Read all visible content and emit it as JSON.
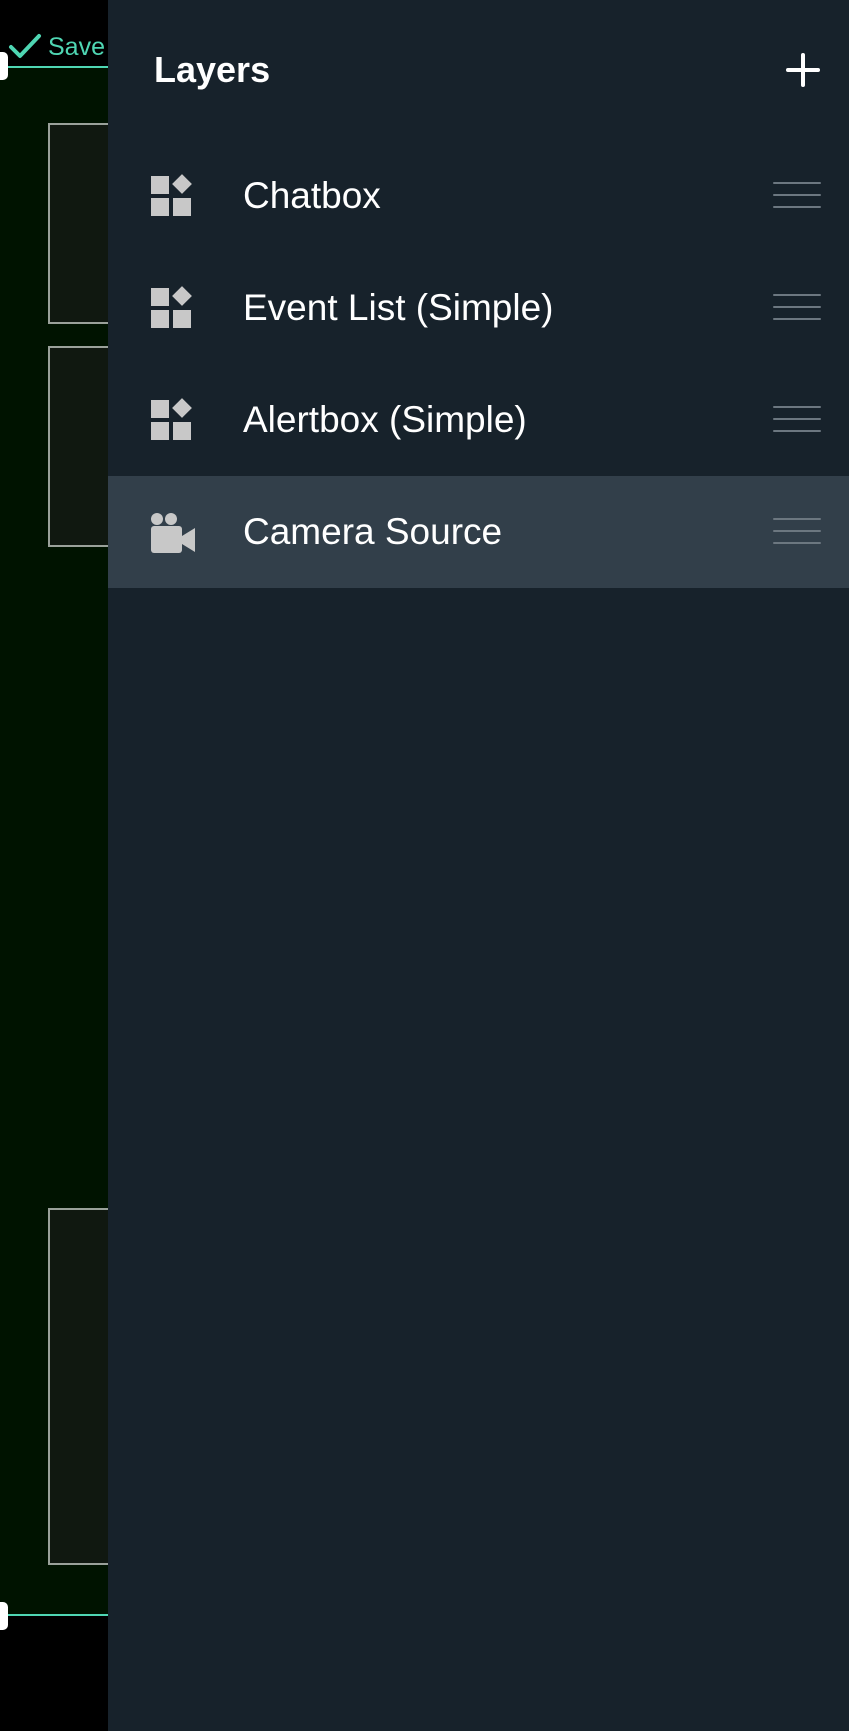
{
  "colors": {
    "panel_bg": "#17222b",
    "selected_row_bg": "#323f4a",
    "accent": "#4fd6b3",
    "stage_bg": "#001300",
    "icon_gray": "#c8c8c8"
  },
  "canvas": {
    "save_label": "Save",
    "save_icon": "check-icon"
  },
  "panel": {
    "title": "Layers",
    "add_icon": "plus-icon",
    "layers": [
      {
        "label": "Chatbox",
        "icon": "widget-icon",
        "selected": false
      },
      {
        "label": "Event List (Simple)",
        "icon": "widget-icon",
        "selected": false
      },
      {
        "label": "Alertbox (Simple)",
        "icon": "widget-icon",
        "selected": false
      },
      {
        "label": "Camera Source",
        "icon": "camera-icon",
        "selected": true
      }
    ]
  }
}
